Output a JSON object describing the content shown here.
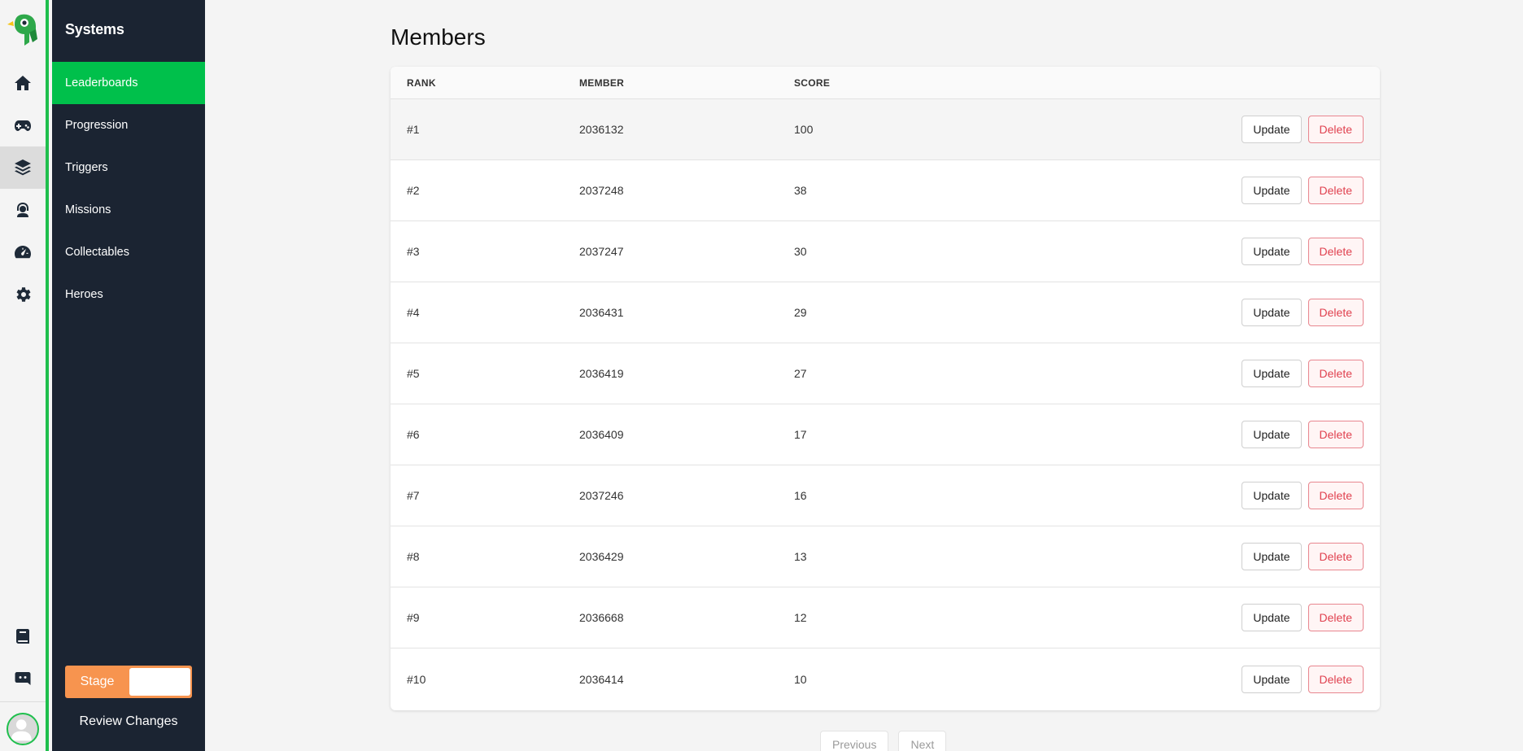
{
  "rail": {
    "items": [
      {
        "icon": "home-icon"
      },
      {
        "icon": "gamepad-icon"
      },
      {
        "icon": "layers-icon",
        "active": true
      },
      {
        "icon": "support-agent-icon"
      },
      {
        "icon": "speedometer-icon"
      },
      {
        "icon": "gear-icon"
      }
    ],
    "bottom": [
      {
        "icon": "book-icon"
      },
      {
        "icon": "discord-icon"
      }
    ]
  },
  "sidebar": {
    "title": "Systems",
    "items": [
      {
        "label": "Leaderboards",
        "active": true
      },
      {
        "label": "Progression"
      },
      {
        "label": "Triggers"
      },
      {
        "label": "Missions"
      },
      {
        "label": "Collectables"
      },
      {
        "label": "Heroes"
      }
    ],
    "stage_label": "Stage",
    "review_label": "Review Changes"
  },
  "main": {
    "title": "Members",
    "columns": {
      "rank": "RANK",
      "member": "MEMBER",
      "score": "SCORE"
    },
    "rows": [
      {
        "rank": "#1",
        "member": "2036132",
        "score": "100"
      },
      {
        "rank": "#2",
        "member": "2037248",
        "score": "38"
      },
      {
        "rank": "#3",
        "member": "2037247",
        "score": "30"
      },
      {
        "rank": "#4",
        "member": "2036431",
        "score": "29"
      },
      {
        "rank": "#5",
        "member": "2036419",
        "score": "27"
      },
      {
        "rank": "#6",
        "member": "2036409",
        "score": "17"
      },
      {
        "rank": "#7",
        "member": "2037246",
        "score": "16"
      },
      {
        "rank": "#8",
        "member": "2036429",
        "score": "13"
      },
      {
        "rank": "#9",
        "member": "2036668",
        "score": "12"
      },
      {
        "rank": "#10",
        "member": "2036414",
        "score": "10"
      }
    ],
    "update_label": "Update",
    "delete_label": "Delete",
    "pager": {
      "previous": "Previous",
      "next": "Next"
    }
  },
  "colors": {
    "accent_green": "#00c04b",
    "sidebar_bg": "#1b2432",
    "stage_orange": "#f7944f",
    "delete_red": "#e0414f"
  }
}
